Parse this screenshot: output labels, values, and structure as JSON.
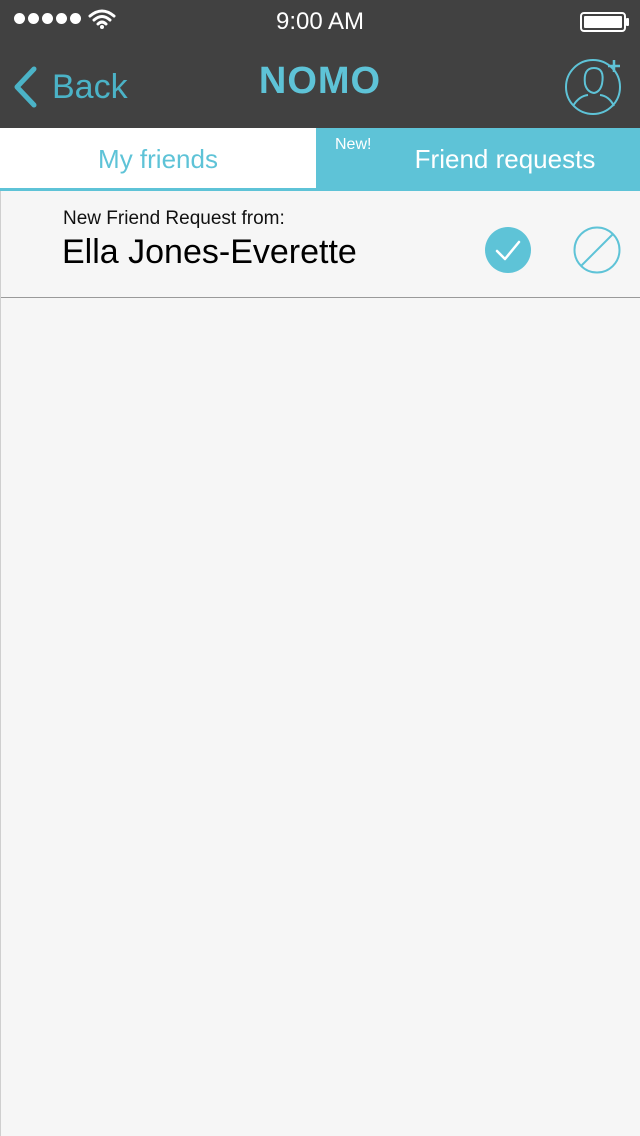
{
  "status_bar": {
    "time": "9:00 AM",
    "signal_icon": "signal-dots-icon",
    "wifi_icon": "wifi-icon",
    "battery_icon": "battery-icon"
  },
  "nav": {
    "back_label": "Back",
    "back_icon": "chevron-left-icon",
    "title": "NOMO",
    "add_friend_icon": "add-friend-icon"
  },
  "tabs": {
    "my_friends": "My friends",
    "friend_requests": "Friend requests",
    "new_badge": "New!"
  },
  "request": {
    "caption": "New Friend Request from:",
    "name": "Ella Jones-Everette",
    "accept_icon": "checkmark-icon",
    "decline_icon": "block-icon"
  },
  "colors": {
    "accent": "#5ec3d7",
    "bar": "#414141",
    "background": "#f6f6f6"
  }
}
